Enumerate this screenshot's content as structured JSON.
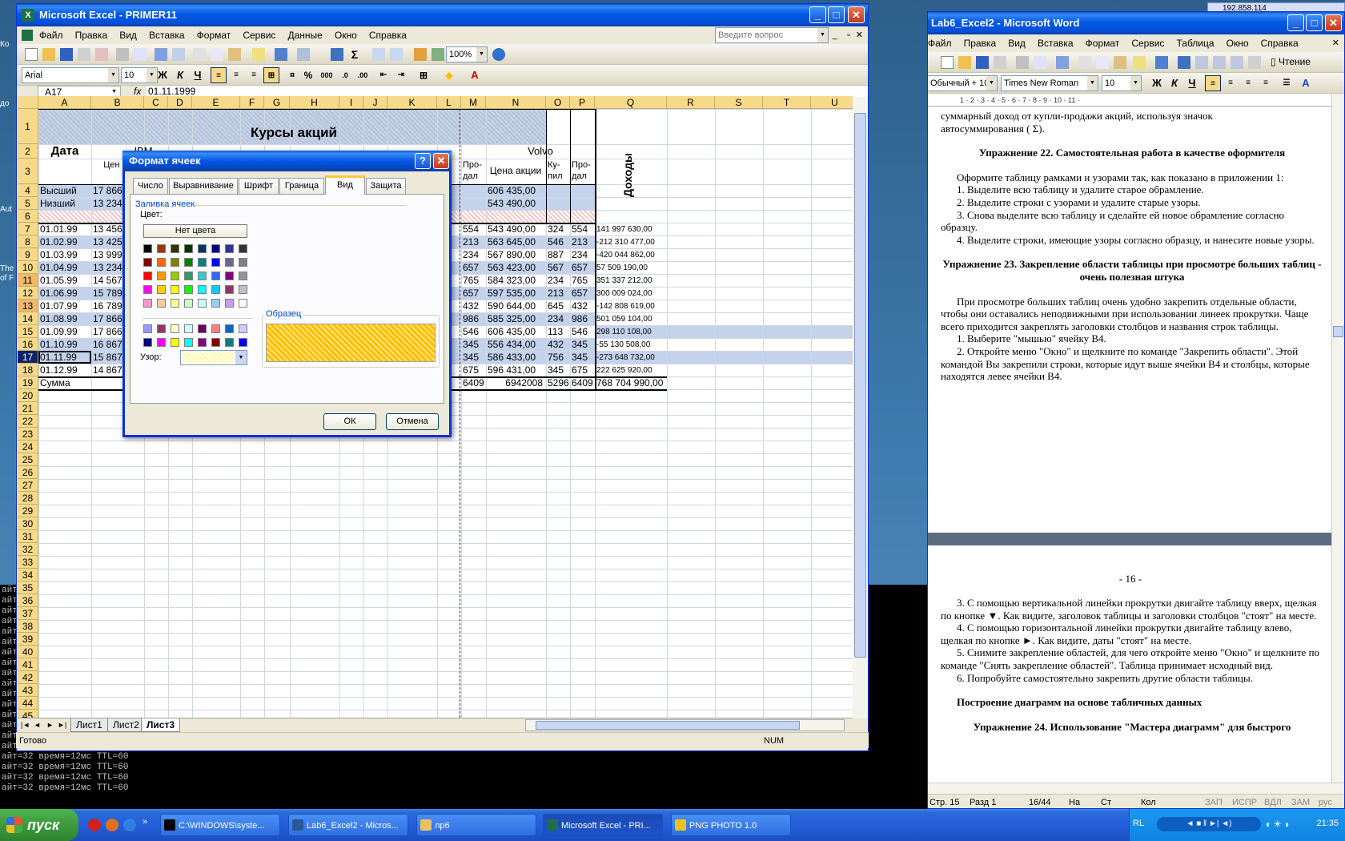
{
  "desktop": {
    "marks": [
      "Ко",
      "до",
      "Aut",
      "The",
      "of F"
    ],
    "console_lines": [
      "айт=32 время=12мс TTL=60",
      "айт=32 время=12мс TTL=60",
      "айт=32 время=12мс TTL=60",
      "айт=32 время=12мс TTL=60",
      "айт=32 время=12мс TTL=60",
      "айт=32 время=12мс TTL=60",
      "айт=32 время=12мс TTL=60",
      "айт=32 время=12мс TTL=60",
      "айт=32 время=12мс TTL=60",
      "айт=32 время=12мс TTL=60",
      "айт=32 время=12мс TTL=60",
      "айт=32 время=12мс TTL=60",
      "айт=32 время=12мс TTL=60",
      "айт=32 время=12мс TTL=60",
      "айт=32 время=12мс TTL=60",
      "айт=32 время=12мс TTL=60",
      "айт=32 время=12мс TTL=60",
      "айт=32 время=12мс TTL=60",
      "айт=32 время=12мс TTL=60",
      "айт=32 время=12мс TTL=60"
    ],
    "mini_window_title": "192.858.114"
  },
  "excel": {
    "title": "Microsoft Excel - PRIMER11",
    "menu": [
      "Файл",
      "Правка",
      "Вид",
      "Вставка",
      "Формат",
      "Сервис",
      "Данные",
      "Окно",
      "Справка"
    ],
    "help_placeholder": "Введите вопрос",
    "zoom": "100%",
    "font": "Arial",
    "font_size": "10",
    "bold": "Ж",
    "italic": "К",
    "underline": "Ч",
    "percent": "%",
    "thousands": "000",
    "name_box": "A17",
    "fx": "fx",
    "formula": "01.11.1999",
    "columns": [
      "A",
      "B",
      "C",
      "D",
      "E",
      "F",
      "G",
      "H",
      "I",
      "J",
      "K",
      "L",
      "M",
      "N",
      "O",
      "P",
      "Q",
      "R",
      "S",
      "T",
      "U"
    ],
    "sheet": {
      "title": "Курсы акций",
      "date_header": "Дата",
      "ibm_fragment": "IBM",
      "b3_fragment": "Цен акци",
      "volvo": "Volvo",
      "price_header": "Цена акции",
      "buy_header": "Ку-пил",
      "sell_header": "Про-дал",
      "m_sell_header": "Про-дал",
      "income_header": "Доходы",
      "rows": [
        {
          "a": "Высший",
          "b": "17 866",
          "m": "",
          "n": "606 435,00",
          "o": "",
          "p": "",
          "q": ""
        },
        {
          "a": "Низший",
          "b": "13 234",
          "m": "",
          "n": "543 490,00",
          "o": "",
          "p": "",
          "q": ""
        },
        {
          "a": "",
          "b": "",
          "m": "",
          "n": "",
          "o": "",
          "p": "",
          "q": ""
        },
        {
          "a": "01.01.99",
          "b": "13 456",
          "m": "554",
          "n": "543 490,00",
          "o": "324",
          "p": "554",
          "q": "141 997 630,00"
        },
        {
          "a": "01.02.99",
          "b": "13 425",
          "m": "213",
          "n": "563 645,00",
          "o": "546",
          "p": "213",
          "q": "-212 310 477,00"
        },
        {
          "a": "01.03.99",
          "b": "13 999",
          "m": "234",
          "n": "567 890,00",
          "o": "887",
          "p": "234",
          "q": "-420 044 862,00"
        },
        {
          "a": "01.04.99",
          "b": "13 234",
          "m": "657",
          "n": "563 423,00",
          "o": "567",
          "p": "657",
          "q": "57 509 190,00"
        },
        {
          "a": "01.05.99",
          "b": "14 567",
          "m": "765",
          "n": "584 323,00",
          "o": "234",
          "p": "765",
          "q": "351 337 212,00"
        },
        {
          "a": "01.06.99",
          "b": "15 789",
          "m": "657",
          "n": "597 535,00",
          "o": "213",
          "p": "657",
          "q": "300 009 024,00"
        },
        {
          "a": "01.07.99",
          "b": "16 789",
          "m": "432",
          "n": "590 644,00",
          "o": "645",
          "p": "432",
          "q": "-142 808 619,00"
        },
        {
          "a": "01.08.99",
          "b": "17 866",
          "m": "986",
          "n": "585 325,00",
          "o": "234",
          "p": "986",
          "q": "501 059 104,00"
        },
        {
          "a": "01.09.99",
          "b": "17 866",
          "m": "546",
          "n": "606 435,00",
          "o": "113",
          "p": "546",
          "q": "298 110 108,00"
        },
        {
          "a": "01.10.99",
          "b": "16 867",
          "m": "345",
          "n": "556 434,00",
          "o": "432",
          "p": "345",
          "q": "-55 130 508,00"
        },
        {
          "a": "01.11.99",
          "b": "15 867",
          "m": "345",
          "n": "586 433,00",
          "o": "756",
          "p": "345",
          "q": "-273 648 732,00"
        },
        {
          "a": "01.12.99",
          "b": "14 867",
          "m": "675",
          "n": "596 431,00",
          "o": "345",
          "p": "675",
          "q": "222 625 920,00"
        },
        {
          "a": "Сумма",
          "b": "",
          "m": "6409",
          "n": "6942008",
          "o": "5296",
          "p": "6409",
          "q": "768 704 990,00"
        }
      ]
    },
    "sheet_tabs": [
      "Лист1",
      "Лист2",
      "Лист3"
    ],
    "active_tab": "Лист3",
    "status_ready": "Готово",
    "status_num": "NUM"
  },
  "dialog": {
    "title": "Формат ячеек",
    "tabs": [
      "Число",
      "Выравнивание",
      "Шрифт",
      "Граница",
      "Вид",
      "Защита"
    ],
    "active_tab": "Вид",
    "group": "Заливка ячеек",
    "color_label": "Цвет:",
    "no_color": "Нет цвета",
    "sample_label": "Образец",
    "pattern_label": "Узор:",
    "ok": "ОК",
    "cancel": "Отмена",
    "sample_color": "#ffbf00",
    "palette": [
      [
        "#000000",
        "#993300",
        "#333300",
        "#003300",
        "#003366",
        "#000080",
        "#333399",
        "#333333"
      ],
      [
        "#800000",
        "#ff6600",
        "#808000",
        "#008000",
        "#008080",
        "#0000ff",
        "#666699",
        "#808080"
      ],
      [
        "#ff0000",
        "#ff9900",
        "#99cc00",
        "#339966",
        "#33cccc",
        "#3366ff",
        "#800080",
        "#969696"
      ],
      [
        "#ff00ff",
        "#ffcc00",
        "#ffff00",
        "#00ff00",
        "#00ffff",
        "#00ccff",
        "#993366",
        "#c0c0c0"
      ],
      [
        "#ff99cc",
        "#ffcc99",
        "#ffff99",
        "#ccffcc",
        "#ccffff",
        "#99ccff",
        "#cc99ff",
        "#ffffff"
      ]
    ],
    "palette_extra": [
      [
        "#9999ff",
        "#993366",
        "#ffffcc",
        "#ccffff",
        "#660066",
        "#ff8080",
        "#0066cc",
        "#ccccff"
      ],
      [
        "#000080",
        "#ff00ff",
        "#ffff00",
        "#00ffff",
        "#800080",
        "#800000",
        "#008080",
        "#0000ff"
      ]
    ]
  },
  "word": {
    "title": "Lab6_Excel2 - Microsoft Word",
    "menu": [
      "Файл",
      "Правка",
      "Вид",
      "Вставка",
      "Формат",
      "Сервис",
      "Таблица",
      "Окно",
      "Справка"
    ],
    "reading": "Чтение",
    "style": "Обычный + 10 пт",
    "font": "Times New Roman",
    "size": "10",
    "bold": "Ж",
    "italic": "К",
    "underline": "Ч",
    "ruler": "1 · 2 · 3 · 4 · 5 · 6 · 7 · 8 · 9 · 10 · 11 ·",
    "page1": [
      {
        "cls": "",
        "t": "суммарный доход от купли-продажи акций, используя значок"
      },
      {
        "cls": "",
        "t": "автосуммирования ( Σ)."
      },
      {
        "cls": "h gap",
        "t": "Упражнение 22. Самостоятельная работа в качестве оформителя"
      },
      {
        "cls": "ind gap",
        "t": "Оформите таблицу рамками и узорами так, как показано в  приложении 1:"
      },
      {
        "cls": "ind",
        "t": "1. Выделите всю таблицу и удалите старое обрамление."
      },
      {
        "cls": "ind",
        "t": "2. Выделите строки с узорами и удалите старые узоры."
      },
      {
        "cls": "ind",
        "t": "3. Снова выделите всю таблицу и сделайте ей новое обрамление согласно образцу."
      },
      {
        "cls": "ind",
        "t": "4. Выделите строки, имеющие узоры согласно образцу, и нанесите новые узоры."
      },
      {
        "cls": "h gap",
        "t": "Упражнение 23. Закрепление области таблицы при просмотре больших таблиц - очень полезная штука"
      },
      {
        "cls": "ind gap",
        "t": "При просмотре больших таблиц очень удобно закрепить отдельные области, чтобы они оставались неподвижными при использовании линеек прокрутки. Чаще всего приходится закреплять заголовки столбцов и названия строк таблицы."
      },
      {
        "cls": "ind",
        "t": "1. Выберите \"мышью\" ячейку B4."
      },
      {
        "cls": "ind",
        "t": "2. Откройте меню \"Окно\" и щелкните по команде \"Закрепить области\". Этой командой Вы закрепили строки, которые идут выше ячейки В4 и столбцы, которые находятся левее ячейки В4."
      }
    ],
    "page_number": "- 16 -",
    "page2": [
      {
        "cls": "ind",
        "t": "3. С помощью вертикальной линейки прокрутки двигайте таблицу вверх, щелкая по кнопке ▼. Как видите, заголовок таблицы и заголовки столбцов \"стоят\" на месте."
      },
      {
        "cls": "ind",
        "t": "4. С помощью горизонтальной линейки прокрутки двигайте таблицу влево, щелкая по кнопке ►. Как видите, даты \"стоят\" на месте."
      },
      {
        "cls": "ind",
        "t": "5. Снимите закрепление областей, для чего откройте меню \"Окно\" и щелкните по команде \"Снять закрепление областей\". Таблица принимает исходный вид."
      },
      {
        "cls": "ind",
        "t": "6. Попробуйте самостоятельно закрепить другие области таблицы."
      },
      {
        "cls": "bold gap",
        "t": "Построение диаграмм на основе табличных данных"
      },
      {
        "cls": "h gap",
        "t": "Упражнение 24. Использование \"Мастера диаграмм\" для быстрого"
      }
    ],
    "status": [
      "Стр. 15",
      "Разд 1",
      "16/44",
      "На",
      "Ст",
      "Кол",
      "ЗАП",
      "ИСПР",
      "ВДЛ",
      "ЗАМ",
      "рус"
    ]
  },
  "taskbar": {
    "start": "пуск",
    "tasks": [
      {
        "label": "C:\\WINDOWS\\syste...",
        "icon_color": "#000000",
        "active": false
      },
      {
        "label": "Lab6_Excel2 - Micros...",
        "icon_color": "#2b579a",
        "active": false
      },
      {
        "label": "лр6",
        "icon_color": "#e8c060",
        "active": false
      },
      {
        "label": "Microsoft Excel - PRI...",
        "icon_color": "#1d7044",
        "active": true
      },
      {
        "label": "PNG PHOTO 1.0",
        "icon_color": "#f0c020",
        "active": false
      }
    ],
    "lang": "RL",
    "clock": "21:35"
  }
}
